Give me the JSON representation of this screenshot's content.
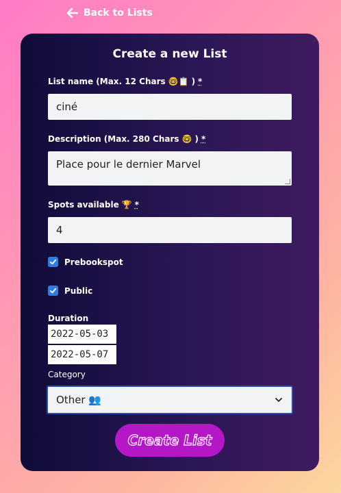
{
  "nav": {
    "back_label": "Back to Lists"
  },
  "form": {
    "title": "Create a new List",
    "list_name": {
      "label": "List name (Max. 12 Chars",
      "emoji": "🤓📋",
      "close": ")",
      "required": "*",
      "value": "ciné"
    },
    "description": {
      "label": "Description (Max. 280 Chars",
      "emoji": "🤓",
      "close": ")",
      "required": "*",
      "value": "Place pour le dernier Marvel"
    },
    "spots": {
      "label": "Spots available",
      "emoji": "🏆",
      "required": "*",
      "value": "4"
    },
    "prebookspot": {
      "label": "Prebookspot",
      "checked": true
    },
    "public": {
      "label": "Public",
      "checked": true
    },
    "duration": {
      "label": "Duration",
      "start": "2022-05-03",
      "end": "2022-05-07"
    },
    "category": {
      "label": "Category",
      "selected": "Other",
      "emoji": "👥"
    },
    "submit_label": "Create List"
  },
  "colors": {
    "accent": "#b317c6",
    "checkbox": "#2f7de1",
    "card_start": "#0f0c39",
    "card_end": "#3f1b60"
  }
}
